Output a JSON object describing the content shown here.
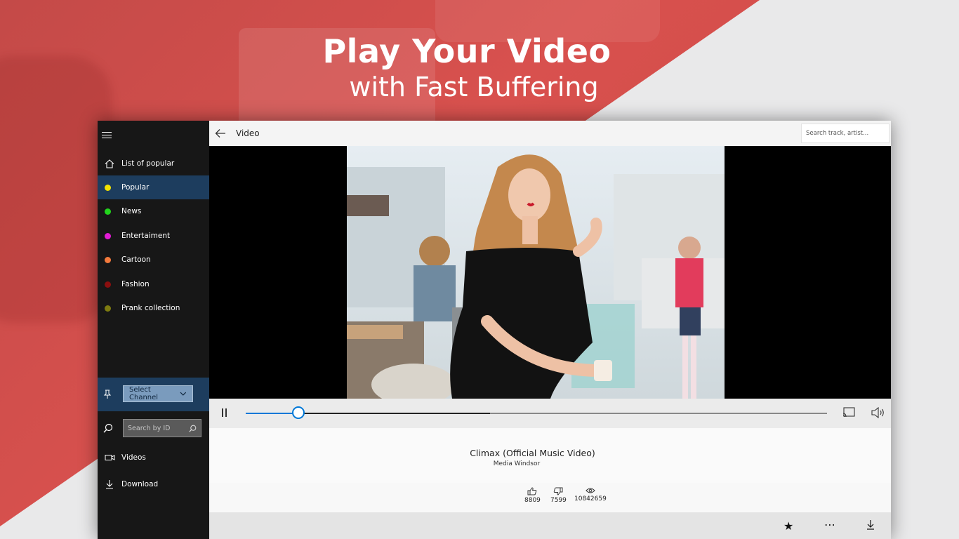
{
  "promo": {
    "line1": "Play Your Video",
    "line2": "with Fast Buffering"
  },
  "sidebar": {
    "items": [
      {
        "label": "List of popular",
        "icon": "home-icon"
      },
      {
        "label": "Popular",
        "color": "#f2e200"
      },
      {
        "label": "News",
        "color": "#22d41c"
      },
      {
        "label": "Entertaiment",
        "color": "#e21bd4"
      },
      {
        "label": "Cartoon",
        "color": "#f47a3c"
      },
      {
        "label": "Fashion",
        "color": "#8b0f0f"
      },
      {
        "label": "Prank collection",
        "color": "#7d7b10"
      }
    ],
    "channel_select": "Select Channel",
    "search_placeholder": "Search by ID",
    "videos": "Videos",
    "download": "Download"
  },
  "topbar": {
    "title": "Video",
    "search_placeholder": "Search track, artist..."
  },
  "player": {
    "progress_fraction": 0.09,
    "buffered_fraction": 0.42,
    "accent": "#0078d7"
  },
  "video": {
    "title": "Climax (Official Music Video)",
    "channel": "Media Windsor",
    "likes": "8809",
    "dislikes": "7599",
    "views": "10842659"
  }
}
